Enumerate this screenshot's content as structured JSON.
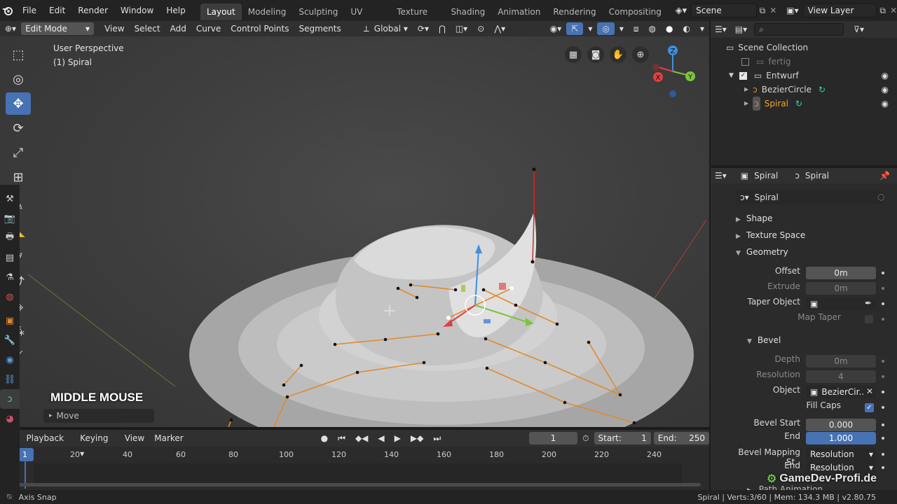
{
  "menu": {
    "items": [
      "File",
      "Edit",
      "Render",
      "Window",
      "Help"
    ],
    "workspaces": [
      "Layout",
      "Modeling",
      "Sculpting",
      "UV Editing",
      "Texture Paint",
      "Shading",
      "Animation",
      "Rendering",
      "Compositing"
    ],
    "active_workspace": "Layout",
    "scene_label": "Scene",
    "view_layer_label": "View Layer"
  },
  "viewport_header": {
    "mode": "Edit Mode",
    "menus": [
      "View",
      "Select",
      "Add",
      "Curve",
      "Control Points",
      "Segments"
    ],
    "transform_orientation": "Global"
  },
  "viewport": {
    "perspective_label": "User Perspective",
    "object_label": "(1) Spiral",
    "operator_key": "MIDDLE MOUSE",
    "operator_name": "Move",
    "gizmo_axes": [
      "Z",
      "X",
      "Y"
    ]
  },
  "timeline": {
    "menus": [
      "Playback",
      "Keying",
      "View",
      "Marker"
    ],
    "current_frame": "1",
    "start_label": "Start:",
    "start_value": "1",
    "end_label": "End:",
    "end_value": "250",
    "ticks": [
      "1",
      "20",
      "40",
      "60",
      "80",
      "100",
      "120",
      "140",
      "160",
      "180",
      "200",
      "220",
      "240"
    ]
  },
  "outliner": {
    "scene_collection": "Scene Collection",
    "rows": [
      {
        "name": "fertig",
        "checked": false,
        "dim": true
      },
      {
        "name": "Entwurf",
        "checked": true,
        "dim": false
      },
      {
        "name": "BezierCircle",
        "dim": false
      },
      {
        "name": "Spiral",
        "dim": false,
        "active": true
      }
    ]
  },
  "properties": {
    "header_object": "Spiral",
    "header_data": "Spiral",
    "datablock_name": "Spiral",
    "panels": {
      "shape": "Shape",
      "texture_space": "Texture Space",
      "geometry": "Geometry",
      "bevel": "Bevel"
    },
    "offset_label": "Offset",
    "offset_value": "0m",
    "extrude_label": "Extrude",
    "extrude_value": "0m",
    "taper_label": "Taper Object",
    "map_taper_label": "Map Taper",
    "depth_label": "Depth",
    "depth_value": "0m",
    "resolution_label": "Resolution",
    "resolution_value": "4",
    "object_label": "Object",
    "object_value": "BezierCir..",
    "fill_caps_label": "Fill Caps",
    "bevel_start_label": "Bevel Start",
    "bevel_start_value": "0.000",
    "end_label": "End",
    "end_value": "1.000",
    "bevel_mapping_label": "Bevel Mapping St..",
    "bevel_mapping_value": "Resolution",
    "end_mapping_label": "End",
    "end_mapping_value": "Resolution",
    "partial_label": "Path Animation"
  },
  "status": {
    "left": "Axis Snap",
    "right": "Spiral | Verts:3/60 | Mem: 134.3 MB | v2.80.75"
  },
  "watermark": "GameDev-Profi.de",
  "colors": {
    "accent_blue": "#4772b3",
    "active_orange": "#f5a623",
    "curve_orange": "#e08a2e",
    "curve_teal": "#3fd0b0"
  }
}
